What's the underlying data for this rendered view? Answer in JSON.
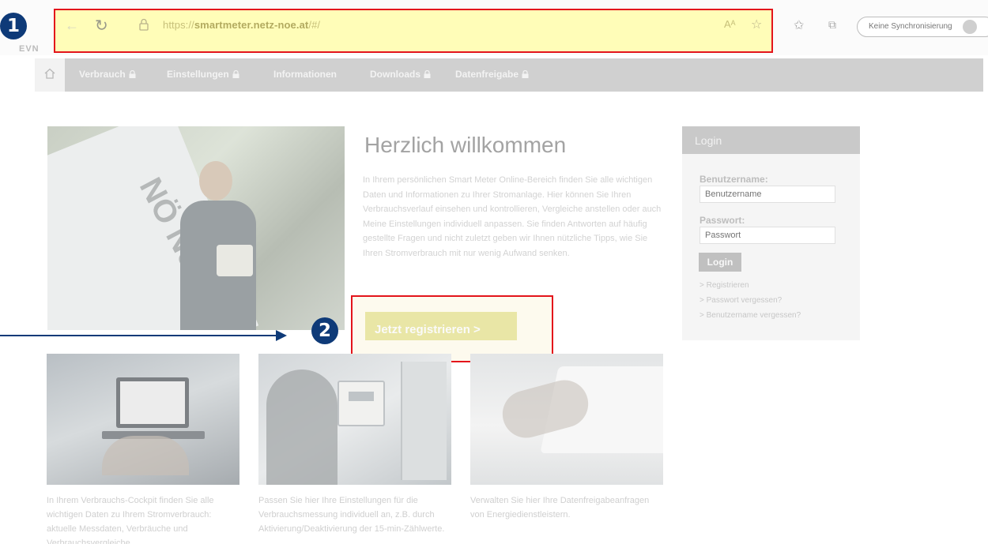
{
  "markers": {
    "one": "1",
    "two": "2"
  },
  "browser": {
    "url_prefix": "https://",
    "url_domain": "smartmeter.netz-noe.at",
    "url_path": "/#/",
    "read_aloud": "Aᴬ",
    "sync_label": "Keine Synchronisierung"
  },
  "site": {
    "logo": "EVN",
    "nav": [
      {
        "label": "Verbrauch"
      },
      {
        "label": "Einstellungen"
      },
      {
        "label": "Informationen"
      },
      {
        "label": "Downloads"
      },
      {
        "label": "Datenfreigabe"
      }
    ]
  },
  "hero": {
    "truck_text": "NÖ Netz",
    "title": "Herzlich willkommen",
    "body": "In Ihrem persönlichen Smart Meter Online-Bereich finden Sie alle wichtigen Daten und Informationen zu Ihrer Stromanlage. Hier können Sie Ihren Verbrauchsverlauf einsehen und kontrollieren, Vergleiche anstellen oder auch Meine Einstellungen individuell anpassen. Sie finden Antworten auf häufig gestellte Fragen und nicht zuletzt geben wir Ihnen nützliche Tipps, wie Sie Ihren Stromverbrauch mit nur wenig Aufwand senken.",
    "register_button": "Jetzt registrieren >"
  },
  "login": {
    "title": "Login",
    "username_label": "Benutzername:",
    "username_placeholder": "Benutzername",
    "password_label": "Passwort:",
    "password_placeholder": "Passwort",
    "submit": "Login",
    "links": [
      "> Registrieren",
      "> Passwort vergessen?",
      "> Benutzername vergessen?"
    ]
  },
  "cards": [
    {
      "text": "In Ihrem Verbrauchs-Cockpit finden Sie alle wichtigen Daten zu Ihrem Stromverbrauch: aktuelle Messdaten, Verbräuche und Verbrauchsvergleiche."
    },
    {
      "text": "Passen Sie hier Ihre Einstellungen für die Verbrauchsmessung individuell an, z.B. durch Aktivierung/Deaktivierung der 15-min-Zählwerte."
    },
    {
      "text": "Verwalten Sie hier Ihre Datenfreigabeanfragen von Energiedienstleistern."
    }
  ]
}
